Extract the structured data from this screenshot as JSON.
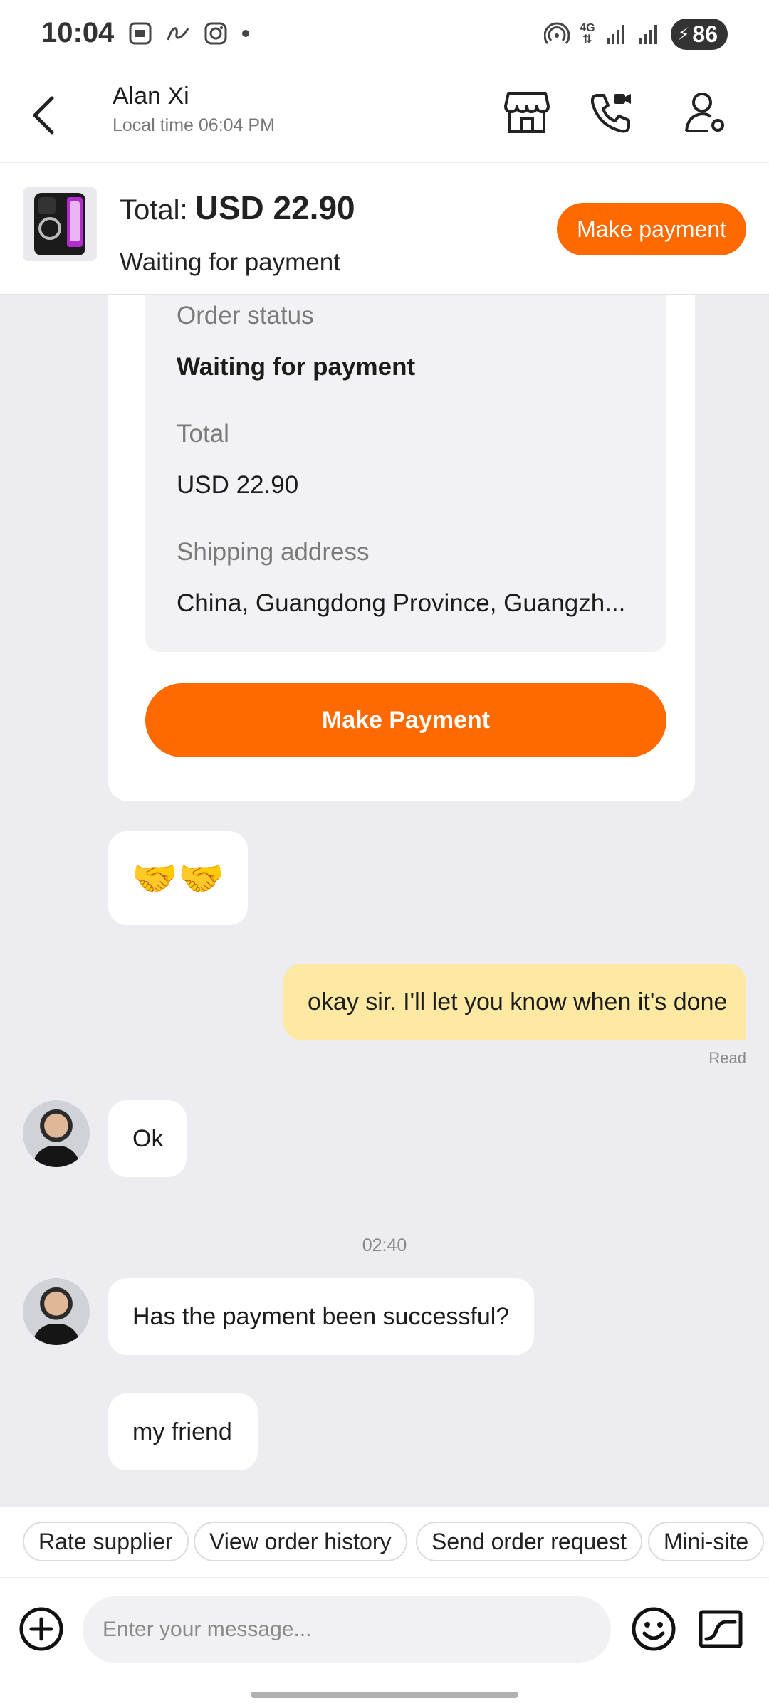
{
  "status_bar": {
    "time": "10:04",
    "network": "4G",
    "battery": "86",
    "left_icons": [
      "screenshot-icon",
      "link-icon",
      "instagram-icon",
      "dot-icon"
    ],
    "right_icons": [
      "hotspot-icon",
      "data-4g-icon",
      "signal-icon",
      "signal-icon",
      "battery-icon"
    ]
  },
  "header": {
    "contact_name": "Alan Xi",
    "local_time": "Local time 06:04 PM",
    "icons": [
      "back-icon",
      "store-icon",
      "video-call-icon",
      "contact-settings-icon"
    ]
  },
  "order_banner": {
    "total_label": "Total:",
    "total_value": "USD 22.90",
    "status": "Waiting for payment",
    "button": "Make payment"
  },
  "order_card": {
    "status_label": "Order status",
    "status_value": "Waiting for payment",
    "total_label": "Total",
    "total_value": "USD 22.90",
    "address_label": "Shipping address",
    "address_value": "China, Guangdong Province, Guangzh...",
    "button": "Make Payment"
  },
  "messages": [
    {
      "from": "supplier",
      "text": "🤝🤝"
    },
    {
      "from": "me",
      "text": "okay sir. I'll let you know when it's done",
      "receipt": "Read"
    },
    {
      "from": "supplier",
      "text": "Ok"
    },
    {
      "separator": "02:40"
    },
    {
      "from": "supplier",
      "text": "Has the payment been successful?"
    },
    {
      "from": "supplier",
      "text": "my friend"
    }
  ],
  "quick_actions": [
    "Rate supplier",
    "View order history",
    "Send order request",
    "Mini-site"
  ],
  "input": {
    "placeholder": "Enter your message...",
    "icons": [
      "plus-icon",
      "emoji-icon",
      "chart-icon"
    ]
  },
  "colors": {
    "accent": "#ff6a00",
    "my_bubble": "#fde9a2",
    "chat_background": "#ececf1"
  }
}
